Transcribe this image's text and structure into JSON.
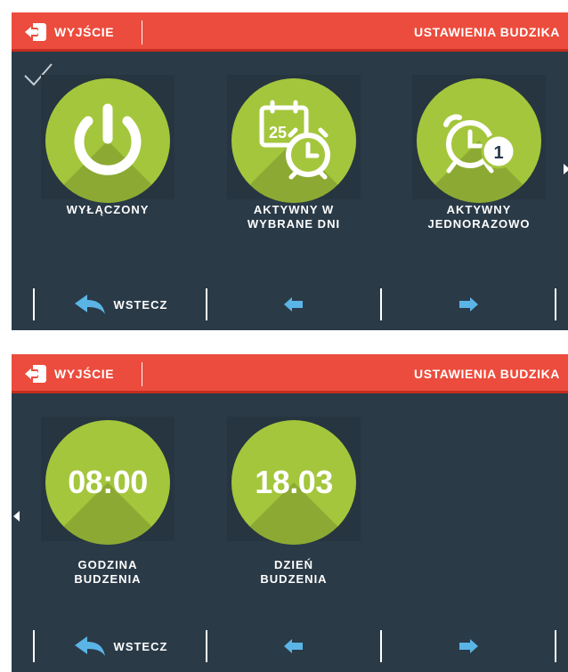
{
  "panel1": {
    "header": {
      "exit_label": "WYJŚCIE",
      "title": "USTAWIENIA BUDZIKA"
    },
    "options": [
      {
        "line1": "WYŁĄCZONY",
        "line2": ""
      },
      {
        "line1": "AKTYWNY W",
        "line2": "WYBRANE DNI",
        "calendar_day": "25"
      },
      {
        "line1": "AKTYWNY",
        "line2": "JEDNORAZOWO",
        "badge": "1"
      }
    ],
    "footer": {
      "back_label": "WSTECZ"
    }
  },
  "panel2": {
    "header": {
      "exit_label": "WYJŚCIE",
      "title": "USTAWIENIA BUDZIKA"
    },
    "options": [
      {
        "value": "08:00",
        "line1": "GODZINA",
        "line2": "BUDZENIA"
      },
      {
        "value": "18.03",
        "line1": "DZIEŃ",
        "line2": "BUDZENIA"
      }
    ],
    "footer": {
      "back_label": "WSTECZ"
    }
  },
  "colors": {
    "header_red": "#ec4c3d",
    "panel_bg": "#2a3a47",
    "circle_green": "#a4c63c",
    "arrow_blue": "#5bb4e6"
  },
  "icons": [
    "exit-icon",
    "checkmark-icon",
    "power-icon",
    "calendar-alarm-icon",
    "alarm-once-icon",
    "back-arrow-icon",
    "arrow-left-icon",
    "arrow-right-icon",
    "scroll-right-icon",
    "scroll-left-icon"
  ]
}
